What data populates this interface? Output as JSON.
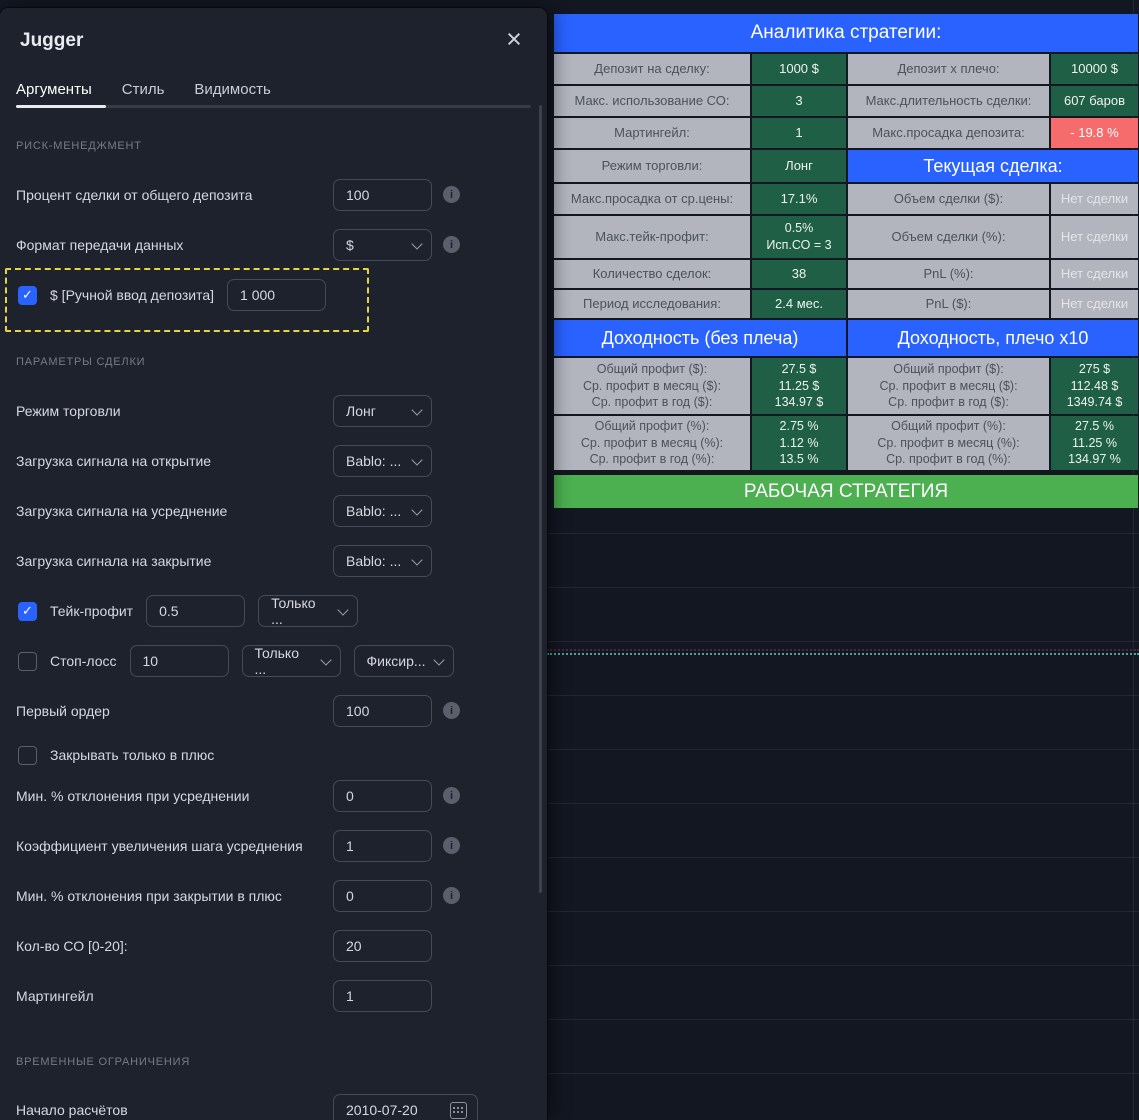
{
  "icons": {
    "close": "×",
    "check": "✓",
    "info": "i"
  },
  "colors": {
    "accent_blue": "#2962ff",
    "table_blue": "#2962ff",
    "table_green": "#1f5f46",
    "table_red": "#f66c6c",
    "table_gray": "#b2b5be",
    "banner_green": "#4caf50",
    "highlight_yellow": "#e5d63f",
    "dialog_bg": "#1e222d",
    "chart_bg": "#131722"
  },
  "dialog": {
    "title": "Jugger",
    "tabs": [
      {
        "label": "Аргументы"
      },
      {
        "label": "Стиль"
      },
      {
        "label": "Видимость"
      }
    ],
    "sections": {
      "risk": "РИСК-МЕНЕДЖМЕНТ",
      "trade": "ПАРАМЕТРЫ СДЕЛКИ",
      "time": "ВРЕМЕННЫЕ ОГРАНИЧЕНИЯ"
    },
    "fields": {
      "percent_of_deposit": {
        "label": "Процент сделки от общего депозита",
        "value": "100"
      },
      "data_format": {
        "label": "Формат передачи данных",
        "value": "$"
      },
      "manual_deposit": {
        "label": "$ [Ручной ввод депозита]",
        "value": "1 000"
      },
      "trade_mode": {
        "label": "Режим торговли",
        "value": "Лонг"
      },
      "signal_open": {
        "label": "Загрузка сигнала на открытие",
        "value": "Bablo: ..."
      },
      "signal_avg": {
        "label": "Загрузка сигнала на усреднение",
        "value": "Bablo: ..."
      },
      "signal_close": {
        "label": "Загрузка сигнала на закрытие",
        "value": "Bablo: ..."
      },
      "take_profit": {
        "label": "Тейк-профит",
        "value": "0.5",
        "mode": "Только ..."
      },
      "stop_loss": {
        "label": "Стоп-лосс",
        "value": "10",
        "mode": "Только ...",
        "type": "Фиксир..."
      },
      "first_order": {
        "label": "Первый ордер",
        "value": "100"
      },
      "close_plus_only": {
        "label": "Закрывать только в плюс"
      },
      "min_dev_avg": {
        "label": "Мин. % отклонения при усреднении",
        "value": "0"
      },
      "avg_step_coef": {
        "label": "Коэффициент увеличения шага усреднения",
        "value": "1"
      },
      "min_dev_close": {
        "label": "Мин. % отклонения при закрытии в плюс",
        "value": "0"
      },
      "so_count": {
        "label": "Кол-во СО [0-20]:",
        "value": "20"
      },
      "martingale": {
        "label": "Мартингейл",
        "value": "1"
      },
      "calc_start": {
        "label": "Начало расчётов",
        "value": "2010-07-20"
      }
    }
  },
  "analytics": {
    "title": "Аналитика стратегии:",
    "rows": [
      {
        "l1": "Депозит на сделку:",
        "v1": "1000 $",
        "l2": "Депозит х плечо:",
        "v2": "10000 $"
      },
      {
        "l1": "Макс. использование СО:",
        "v1": "3",
        "l2": "Макс.длительность сделки:",
        "v2": "607 баров"
      },
      {
        "l1": "Мартингейл:",
        "v1": "1",
        "l2": "Макс.просадка депозита:",
        "v2": "- 19.8 %"
      },
      {
        "l1": "Режим торговли:",
        "v1": "Лонг",
        "header": "Текущая сделка:"
      },
      {
        "l1": "Макс.просадка от ср.цены:",
        "v1": "17.1%",
        "l2": "Объем сделки ($):",
        "v2": "Нет сделки"
      },
      {
        "l1": "Макс.тейк-профит:",
        "v1": "0.5%\nИсп.СО = 3",
        "l2": "Объем сделки (%):",
        "v2": "Нет сделки"
      },
      {
        "l1": "Количество сделок:",
        "v1": "38",
        "l2": "PnL (%):",
        "v2": "Нет сделки"
      },
      {
        "l1": "Период исследования:",
        "v1": "2.4 мес.",
        "l2": "PnL ($):",
        "v2": "Нет сделки"
      }
    ],
    "profit_headers": [
      "Доходность (без плеча)",
      "Доходность, плечо х10"
    ],
    "profit_usd": {
      "labels": "Общий профит ($):\nСр. профит в месяц ($):\nСр. профит в год ($):",
      "base": "27.5 $\n11.25 $\n134.97 $",
      "leveraged": "275 $\n112.48 $\n1349.74 $"
    },
    "profit_pct": {
      "labels": "Общий профит (%):\nСр. профит в месяц (%):\nСр. профит в год (%):",
      "base": "2.75 %\n1.12 %\n13.5 %",
      "leveraged": "27.5 %\n11.25 %\n134.97 %"
    },
    "banner": "РАБОЧАЯ СТРАТЕГИЯ"
  }
}
